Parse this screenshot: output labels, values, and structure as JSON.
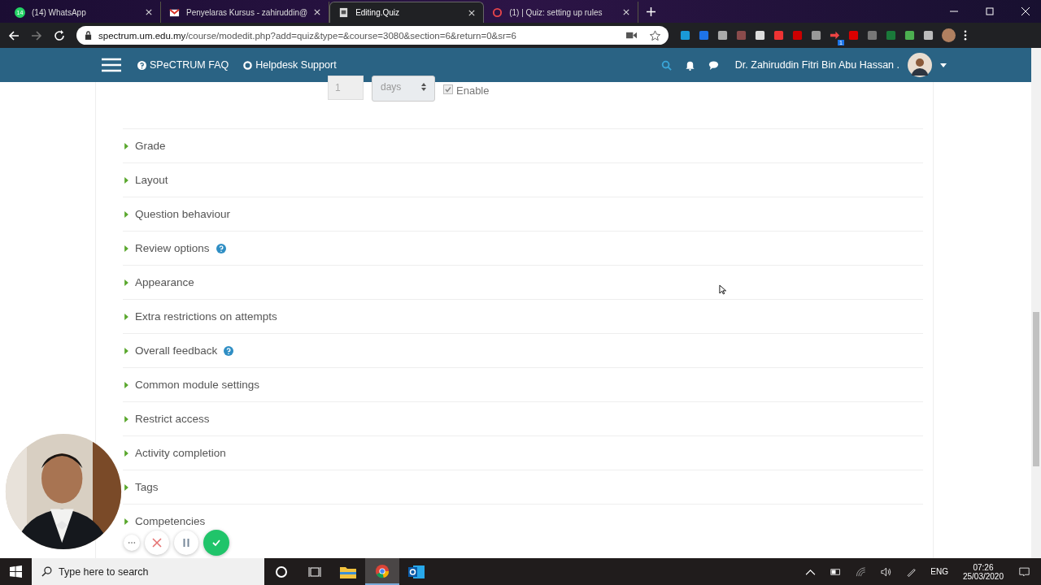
{
  "browser": {
    "tabs": [
      {
        "title": "(14) WhatsApp",
        "kind": "whatsapp",
        "badge": "14",
        "selected": false
      },
      {
        "title": "Penyelaras Kursus - zahiruddin@",
        "kind": "mail",
        "selected": false
      },
      {
        "title": "Editing.Quiz",
        "kind": "doc",
        "selected": true
      },
      {
        "title": "(1) | Quiz: setting up rules",
        "kind": "ring",
        "selected": false
      }
    ],
    "url_host": "spectrum.um.edu.my",
    "url_path": "/course/modedit.php?add=quiz&type=&course=3080&section=6&return=0&sr=6",
    "extension_badge": "1"
  },
  "navbar": {
    "links": [
      "SPeCTRUM FAQ",
      "Helpdesk Support"
    ],
    "user": "Dr. Zahiruddin Fitri Bin Abu Hassan ."
  },
  "form_top": {
    "number": "1",
    "unit": "days",
    "enable": {
      "label": "Enable",
      "checked": true
    }
  },
  "sections": [
    {
      "label": "Grade",
      "help": false
    },
    {
      "label": "Layout",
      "help": false
    },
    {
      "label": "Question behaviour",
      "help": false
    },
    {
      "label": "Review options",
      "help": true
    },
    {
      "label": "Appearance",
      "help": false
    },
    {
      "label": "Extra restrictions on attempts",
      "help": false
    },
    {
      "label": "Overall feedback",
      "help": true
    },
    {
      "label": "Common module settings",
      "help": false
    },
    {
      "label": "Restrict access",
      "help": false
    },
    {
      "label": "Activity completion",
      "help": false
    },
    {
      "label": "Tags",
      "help": false
    },
    {
      "label": "Competencies",
      "help": false
    }
  ],
  "taskbar": {
    "search_placeholder": "Type here to search",
    "apps": [
      {
        "kind": "explorer",
        "selected": false
      },
      {
        "kind": "chrome",
        "selected": true
      },
      {
        "kind": "outlook",
        "selected": false
      }
    ],
    "language": "ENG",
    "time": "07:26",
    "date": "25/03/2020"
  }
}
